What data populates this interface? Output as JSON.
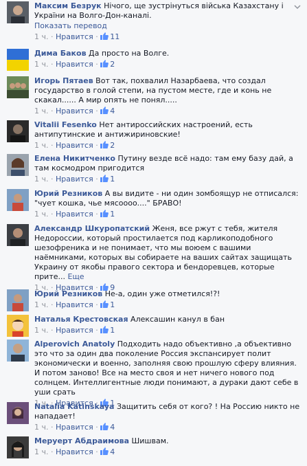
{
  "labels": {
    "like": "Нравится",
    "translate": "Показать перевод",
    "dot": "·"
  },
  "comments": [
    {
      "author": "Максим Безрук",
      "text": "Нічого, ще зустрінуться війська Казахстану і України на Волго-Дон-каналі.",
      "time": "1 ч.",
      "likes": "11",
      "translate": true,
      "avatar": "man-photo"
    },
    {
      "author": "Дима Баков",
      "text": "Да просто на Волге.",
      "time": "1 ч.",
      "likes": "2",
      "avatar": "ukraine-flag"
    },
    {
      "author": "Игорь Пятаев",
      "text": "Вот так, похвалил Назарбаева, что создал государство в голой степи, на пустом месте, где и конь не скакал...... А мир опять не понял.....",
      "time": "1 ч.",
      "likes": "4",
      "avatar": "group-photo"
    },
    {
      "author": "Vitalii Fesenko",
      "text": "Нет антироссийских настроений, есть антипутинские и антижириновские!",
      "time": "1 ч.",
      "likes": "2",
      "avatar": "dark-photo"
    },
    {
      "author": "Елена Никитченко",
      "text": "Путину везде всё надо: там ему базу дай, а там космодром пригодится",
      "time": "1 ч.",
      "likes": "1",
      "avatar": "woman-photo"
    },
    {
      "author": "Юрий Резников",
      "text": "А вы видите - ни один зомбоящур не отписался: \"чует кошка, чье мясоооо....\" БРАВО!",
      "time": "1 ч.",
      "likes": "1",
      "avatar": "man-outdoor"
    },
    {
      "author": "Александр Шкуропатский",
      "text": "Женя, все ржут с тебя, жителя Недороссии, который простилается под карликоподобного шезофреника и не понимает, что мы воюем с вашими наёмниками, которых вы собираете на ваших сайтах защищать Украину от якобы правого сектора и бендоревцев, которые прите...",
      "more": "Еще",
      "time": "1 ч.",
      "likes": "9",
      "avatar": "man-dark"
    },
    {
      "author": "Юрий Резников",
      "text": "Не-а, один уже отметился!?!",
      "time": "1 ч.",
      "likes": "1",
      "avatar": "man-outdoor"
    },
    {
      "author": "Наталья Крестовская",
      "text": "Алексашин канул в бан",
      "time": "1 ч.",
      "likes": "1",
      "avatar": "cartoon"
    },
    {
      "author": "Alperovich Anatoly",
      "text": "Подходить надо объективно ,а объективно это что за один два поколение Россия экспансирует полит экономически и военно, заполняя свою прошлую сферу влияния. И потом заново! Все на место своя и нет ничего нового под солнцем. Интеллигентные люди понимают, а дураки дают себе в уши срать",
      "time": "1 ч.",
      "likes": "1",
      "avatar": "man-sky"
    },
    {
      "author": "Natalia Katinskaya",
      "text": "Защитить себя от кого? ! На Россию никто не нападает!",
      "time": "1 ч.",
      "likes": "4",
      "avatar": "woman-purple"
    },
    {
      "author": "Меруерт Абдраимова",
      "text": "Шишвам.",
      "time": "1 ч.",
      "likes": "4",
      "avatar": "woman-dark"
    }
  ],
  "colors": {
    "link": "#3b5998",
    "meta": "#90949c",
    "text": "#141823",
    "bg": "#f6f7f9"
  }
}
